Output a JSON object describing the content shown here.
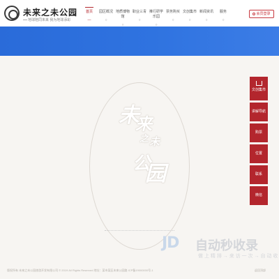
{
  "header": {
    "logo_title": "未来之未公园",
    "logo_slogan": "地球陪同未来 我为地球添彩"
  },
  "nav": {
    "items": [
      {
        "label": "首页",
        "sub": "—",
        "active": true
      },
      {
        "label": "园区概况",
        "sub": "○"
      },
      {
        "label": "地质博物馆",
        "sub": "○"
      },
      {
        "label": "职业三青",
        "sub": "○"
      },
      {
        "label": "推行研学乐园",
        "sub": "○"
      },
      {
        "label": "票务购买",
        "sub": "○"
      },
      {
        "label": "文创集市",
        "sub": "○"
      },
      {
        "label": "新闻资讯",
        "sub": "○"
      },
      {
        "label": "服务",
        "sub": "○"
      }
    ],
    "login_label": "会员登录"
  },
  "calligraphy": [
    "未",
    "来",
    "之",
    "未",
    "公",
    "园"
  ],
  "rail": {
    "items": [
      {
        "label": "文创集市",
        "icon": "cart-icon"
      },
      {
        "label": "讲解导航"
      },
      {
        "label": "购票"
      },
      {
        "label": "位置"
      },
      {
        "label": "联系"
      },
      {
        "label": "微信"
      }
    ]
  },
  "watermark": {
    "logo": "JD",
    "text": "自动秒收录",
    "sub": "做 上 精 排 → 来 访 一 次 → 自 动 收 录 →"
  },
  "footer": {
    "left": "版权所有 未来之未公园旅游开发有限公司 © 2019 All Rights Reserved 地址：某市某区未来公园路 ICP备19000000号-1",
    "right": "返回顶部"
  },
  "colors": {
    "accent": "#b3262d",
    "banner": "#2f73e0"
  }
}
